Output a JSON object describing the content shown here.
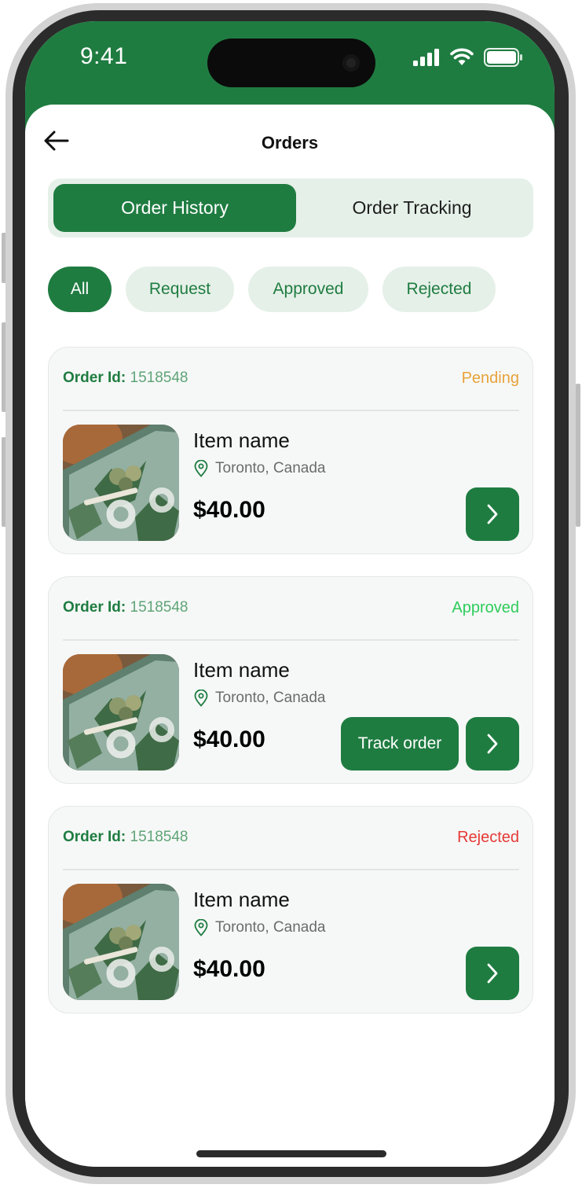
{
  "status_bar": {
    "time": "9:41"
  },
  "header": {
    "title": "Orders"
  },
  "segments": [
    {
      "label": "Order History",
      "active": true
    },
    {
      "label": "Order Tracking",
      "active": false
    }
  ],
  "filters": [
    {
      "label": "All",
      "active": true
    },
    {
      "label": "Request",
      "active": false
    },
    {
      "label": "Approved",
      "active": false
    },
    {
      "label": "Rejected",
      "active": false
    }
  ],
  "orders": [
    {
      "order_id_label": "Order Id:",
      "order_id": "1518548",
      "status": "Pending",
      "status_color": "#E8A23A",
      "item_name": "Item name",
      "location": "Toronto, Canada",
      "price": "$40.00",
      "track_label": null
    },
    {
      "order_id_label": "Order Id:",
      "order_id": "1518548",
      "status": "Approved",
      "status_color": "#2ECC5B",
      "item_name": "Item name",
      "location": "Toronto, Canada",
      "price": "$40.00",
      "track_label": "Track order"
    },
    {
      "order_id_label": "Order Id:",
      "order_id": "1518548",
      "status": "Rejected",
      "status_color": "#E53935",
      "item_name": "Item name",
      "location": "Toronto, Canada",
      "price": "$40.00",
      "track_label": null
    }
  ],
  "colors": {
    "brand": "#1F7C41",
    "brand_light": "#E5F0E8"
  },
  "icons": [
    "back-arrow-icon",
    "signal-icon",
    "wifi-icon",
    "battery-icon",
    "location-pin-icon",
    "chevron-right-icon"
  ]
}
